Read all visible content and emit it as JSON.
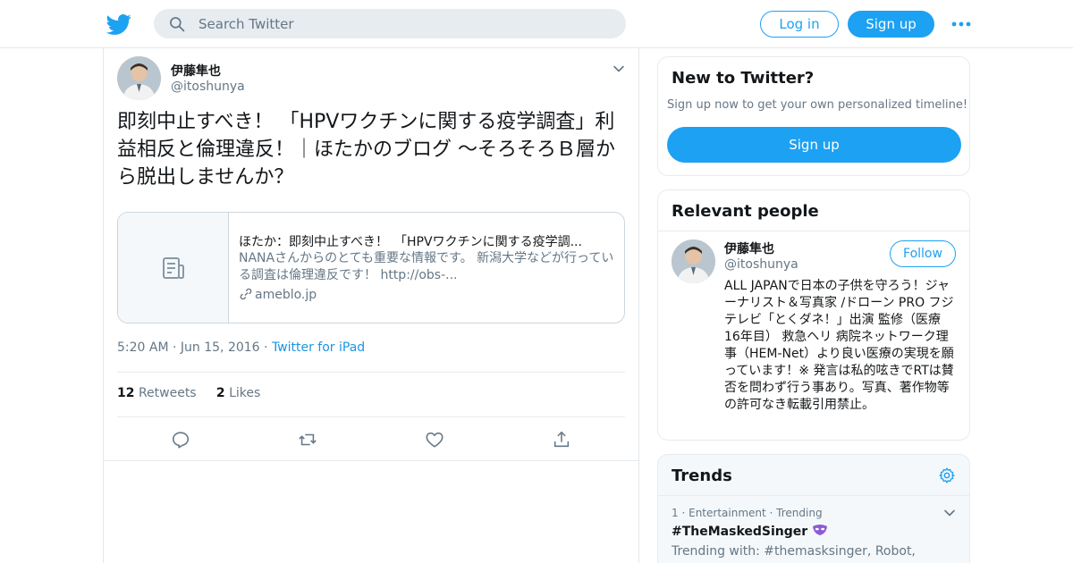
{
  "colors": {
    "brand": "#1da1f2",
    "link": "#1b95e0",
    "muted": "#657786",
    "text": "#14171a",
    "border": "#e1e8ed"
  },
  "nav": {
    "logo_icon": "twitter-bird-icon",
    "search_placeholder": "Search Twitter",
    "login_label": "Log in",
    "signup_label": "Sign up",
    "more_icon": "more-dots-icon"
  },
  "tweet": {
    "author_name": "伊藤隼也",
    "author_handle": "@itoshunya",
    "text": "即刻中止すべき！ 「HPVワクチンに関する疫学調査」利益相反と倫理違反！｜ほたかのブログ ～そろそろＢ層から脱出しませんか？",
    "card": {
      "title": "ほたか：即刻中止すべき！　「HPVワクチンに関する疫学調...",
      "description": "NANAさんからのとても重要な情報です。 新潟大学などが行っている調査は倫理違反です！ http://obs-...",
      "domain": "ameblo.jp"
    },
    "time": "5:20 AM",
    "date": "Jun 15, 2016",
    "source": "Twitter for iPad",
    "retweet_count": "12",
    "retweet_label": "Retweets",
    "like_count": "2",
    "like_label": "Likes"
  },
  "sidebar": {
    "new_to_twitter": {
      "title": "New to Twitter?",
      "subtitle": "Sign up now to get your own personalized timeline!",
      "button": "Sign up"
    },
    "relevant_people": {
      "title": "Relevant people",
      "name": "伊藤隼也",
      "handle": "@itoshunya",
      "follow_label": "Follow",
      "bio": "ALL JAPANで日本の子供を守ろう！ジャーナリスト＆写真家 /ドローン PRO フジテレビ「とくダネ！」出演 監修（医療 16年目） 救急ヘリ 病院ネットワーク理事（HEM-Net）より良い医療の実現を願っています！※ 発言は私的呟きでRTは賛否を問わず行う事あり。写真、著作物等の許可なき転載引用禁止。"
    },
    "trends": {
      "title": "Trends",
      "items": [
        {
          "rank": "1",
          "category": "Entertainment",
          "status": "Trending",
          "name": "#TheMaskedSinger",
          "trending_with": "Trending with: #themasksinger, Robot,"
        }
      ]
    }
  }
}
